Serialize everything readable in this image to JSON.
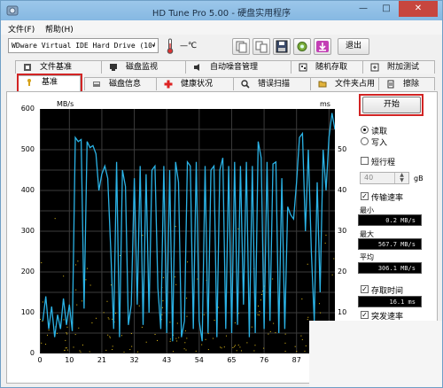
{
  "window": {
    "title": "HD Tune Pro 5.00 - 硬盘实用程序",
    "min": "—",
    "max": "□",
    "close": "✕"
  },
  "menu": [
    {
      "label": "文件(F)"
    },
    {
      "label": "帮助(H)"
    }
  ],
  "toolbar": {
    "drive": "WDware Virtual IDE Hard Drive (10'",
    "drive_arrow": "▾",
    "temperature": "—℃",
    "exit_label": "退出"
  },
  "tabs_row1": [
    {
      "label": "文件基准"
    },
    {
      "label": "磁盘监视"
    },
    {
      "label": "自动噪音管理"
    },
    {
      "label": "随机存取"
    },
    {
      "label": "附加测试"
    }
  ],
  "tabs_row2": [
    {
      "label": "基准"
    },
    {
      "label": "磁盘信息"
    },
    {
      "label": "健康状况"
    },
    {
      "label": "错误扫描"
    },
    {
      "label": "文件夹占用"
    },
    {
      "label": "擦除"
    }
  ],
  "controls": {
    "start_label": "开始",
    "read_label": "读取",
    "write_label": "写入",
    "short_stroke_label": "短行程",
    "short_stroke_value": "40",
    "short_stroke_unit": "gB",
    "transfer_rate_label": "传输速率",
    "min_label": "最小",
    "min_value": "0.2 MB/s",
    "max_label": "最大",
    "max_value": "567.7 MB/s",
    "avg_label": "平均",
    "avg_value": "306.1 MB/s",
    "access_time_label": "存取时间",
    "access_time_value": "16.1 ms",
    "burst_rate_label": "突发速率",
    "burst_rate_value": ""
  },
  "colors": {
    "transfer": "#2bb3e6",
    "access": "#e8c21a",
    "plot_bg": "#000000",
    "grid": "#3c3c3c",
    "highlight": "#d22424"
  },
  "chart_data": {
    "type": "line",
    "xlabel": "",
    "y_unit_left": "MB/s",
    "y_unit_right": "ms",
    "xlim": [
      0,
      100
    ],
    "ylim_left": [
      0,
      600
    ],
    "ylim_right": [
      0,
      60
    ],
    "x_ticks": [
      0,
      10,
      21,
      32,
      43,
      54,
      65,
      76,
      87,
      98
    ],
    "y_ticks_left": [
      0,
      100,
      200,
      300,
      400,
      500,
      600
    ],
    "y_ticks_right": [
      10,
      20,
      30,
      40,
      50
    ],
    "series": [
      {
        "values": [
          [
            1,
            80
          ],
          [
            2,
            140
          ],
          [
            3,
            60
          ],
          [
            4,
            115
          ],
          [
            5,
            40
          ],
          [
            6,
            95
          ],
          [
            7,
            60
          ],
          [
            8,
            135
          ],
          [
            9,
            70
          ],
          [
            10,
            120
          ],
          [
            11,
            55
          ],
          [
            12,
            530
          ],
          [
            13,
            520
          ],
          [
            14,
            525
          ],
          [
            15,
            110
          ],
          [
            16,
            520
          ],
          [
            17,
            505
          ],
          [
            18,
            510
          ],
          [
            19,
            490
          ],
          [
            20,
            400
          ],
          [
            21,
            440
          ],
          [
            22,
            460
          ],
          [
            23,
            430
          ],
          [
            24,
            260
          ],
          [
            25,
            60
          ],
          [
            26,
            470
          ],
          [
            27,
            40
          ],
          [
            28,
            450
          ],
          [
            29,
            410
          ],
          [
            30,
            70
          ],
          [
            31,
            120
          ],
          [
            32,
            430
          ],
          [
            33,
            120
          ],
          [
            34,
            460
          ],
          [
            35,
            70
          ],
          [
            36,
            440
          ],
          [
            37,
            100
          ],
          [
            38,
            450
          ],
          [
            39,
            460
          ],
          [
            40,
            160
          ],
          [
            41,
            60
          ],
          [
            42,
            460
          ],
          [
            43,
            50
          ],
          [
            44,
            450
          ],
          [
            45,
            30
          ],
          [
            46,
            470
          ],
          [
            47,
            420
          ],
          [
            48,
            40
          ],
          [
            49,
            80
          ],
          [
            50,
            470
          ],
          [
            51,
            460
          ],
          [
            52,
            60
          ],
          [
            53,
            470
          ],
          [
            54,
            80
          ],
          [
            55,
            30
          ],
          [
            56,
            460
          ],
          [
            57,
            50
          ],
          [
            58,
            450
          ],
          [
            59,
            460
          ],
          [
            60,
            40
          ],
          [
            61,
            450
          ],
          [
            62,
            480
          ],
          [
            63,
            60
          ],
          [
            64,
            460
          ],
          [
            65,
            50
          ],
          [
            66,
            470
          ],
          [
            67,
            70
          ],
          [
            68,
            460
          ],
          [
            69,
            120
          ],
          [
            70,
            470
          ],
          [
            71,
            40
          ],
          [
            72,
            460
          ],
          [
            73,
            50
          ],
          [
            74,
            520
          ],
          [
            75,
            480
          ],
          [
            76,
            60
          ],
          [
            77,
            470
          ],
          [
            78,
            80
          ],
          [
            79,
            465
          ],
          [
            80,
            470
          ],
          [
            81,
            50
          ],
          [
            82,
            430
          ],
          [
            83,
            60
          ],
          [
            84,
            360
          ],
          [
            85,
            340
          ],
          [
            86,
            330
          ],
          [
            87,
            420
          ],
          [
            88,
            530
          ],
          [
            89,
            540
          ],
          [
            90,
            300
          ],
          [
            91,
            500
          ],
          [
            92,
            250
          ],
          [
            93,
            80
          ],
          [
            94,
            420
          ],
          [
            95,
            150
          ],
          [
            96,
            500
          ],
          [
            97,
            400
          ],
          [
            98,
            530
          ],
          [
            99,
            590
          ],
          [
            100,
            550
          ]
        ]
      }
    ]
  }
}
